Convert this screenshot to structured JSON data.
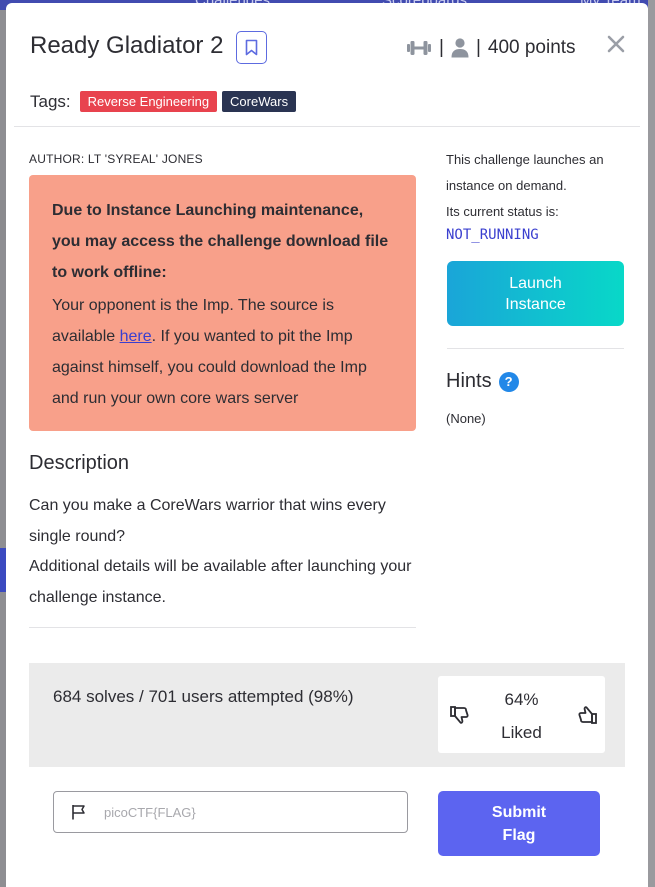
{
  "background": {
    "nav_items": [
      "Challenges",
      "Scoreboards",
      "My Team"
    ]
  },
  "challenge": {
    "title": "Ready Gladiator 2",
    "stats_separator": "|",
    "points": "400 points",
    "tags_label": "Tags:",
    "tags": [
      {
        "label": "Reverse Engineering",
        "color": "#e8434e"
      },
      {
        "label": "CoreWars",
        "color": "#2a3452"
      }
    ],
    "author": "AUTHOR: LT 'SYREAL' JONES",
    "alert": {
      "bold": "Due to Instance Launching maintenance, you may access the challenge download file to work offline:",
      "body_before_link": "Your opponent is the Imp. The source is available ",
      "link_text": "here",
      "body_after_link": ". If you wanted to pit the Imp against himself, you could download the Imp and run your own core wars server"
    },
    "description_heading": "Description",
    "description_lines": [
      "Can you make a CoreWars warrior that wins every single round?",
      "Additional details will be available after launching your challenge instance."
    ]
  },
  "instance": {
    "text_line1": "This challenge launches an instance on demand.",
    "text_line2": "Its current status is:",
    "status": "NOT_RUNNING",
    "launch_label": "Launch Instance"
  },
  "hints": {
    "heading": "Hints",
    "help_glyph": "?",
    "value": "(None)"
  },
  "solves": {
    "text": "684 solves / 701 users attempted (98%)",
    "liked_percent": "64%",
    "liked_label": "Liked"
  },
  "flag": {
    "placeholder": "picoCTF{FLAG}",
    "value": "",
    "submit_label": "Submit Flag"
  },
  "colors": {
    "accent": "#5c64f0",
    "link": "#3a3fcf",
    "alert_bg": "#f8a08a",
    "launch_gradient_start": "#1aa5d8",
    "launch_gradient_end": "#08d8c8"
  }
}
